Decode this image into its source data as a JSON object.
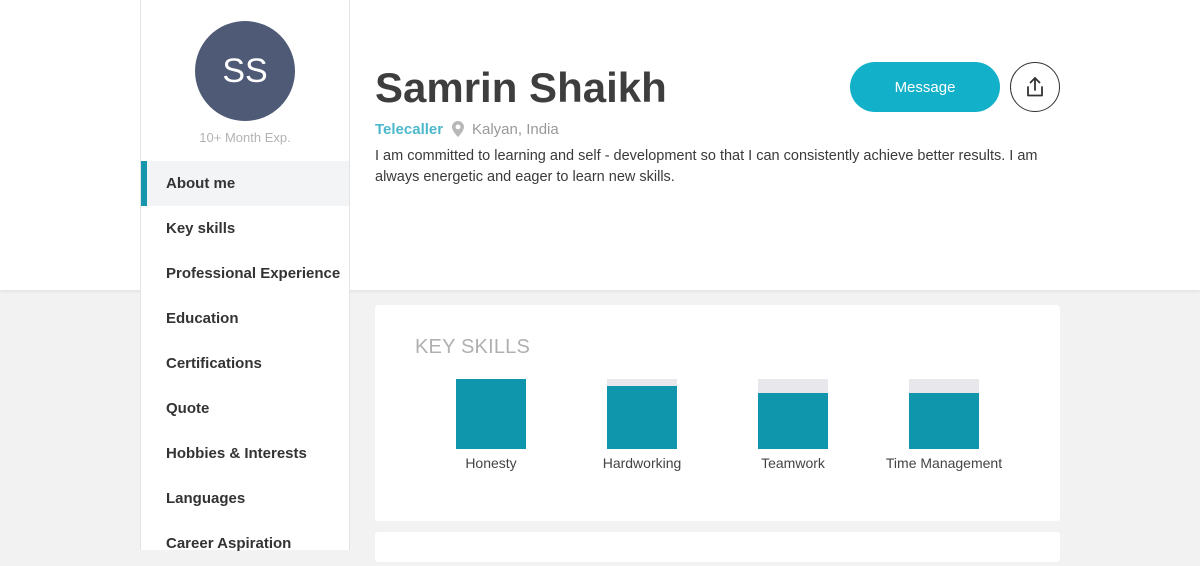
{
  "profile": {
    "initials": "SS",
    "experience": "10+ Month Exp.",
    "name": "Samrin Shaikh",
    "role": "Telecaller",
    "location": "Kalyan, India",
    "bio": "I am committed to learning and self - development so that I can consistently achieve better results. I am always energetic and eager to learn new skills."
  },
  "actions": {
    "message_label": "Message",
    "share_icon": "share-upload-icon"
  },
  "sidebar": {
    "items": [
      {
        "label": "About me",
        "active": true
      },
      {
        "label": "Key skills",
        "active": false
      },
      {
        "label": "Professional Experience",
        "active": false
      },
      {
        "label": "Education",
        "active": false
      },
      {
        "label": "Certifications",
        "active": false
      },
      {
        "label": "Quote",
        "active": false
      },
      {
        "label": "Hobbies & Interests",
        "active": false
      },
      {
        "label": "Languages",
        "active": false
      },
      {
        "label": "Career Aspiration",
        "active": false
      }
    ]
  },
  "key_skills": {
    "title": "KEY SKILLS",
    "skills": [
      {
        "name": "Honesty",
        "level": 1.0
      },
      {
        "name": "Hardworking",
        "level": 0.9
      },
      {
        "name": "Teamwork",
        "level": 0.8
      },
      {
        "name": "Time Management",
        "level": 0.8
      }
    ]
  },
  "colors": {
    "accent": "#12b0c9",
    "skill_fill": "#0f96ad",
    "avatar_bg": "#4e5a76",
    "role_text": "#4db8cb"
  }
}
